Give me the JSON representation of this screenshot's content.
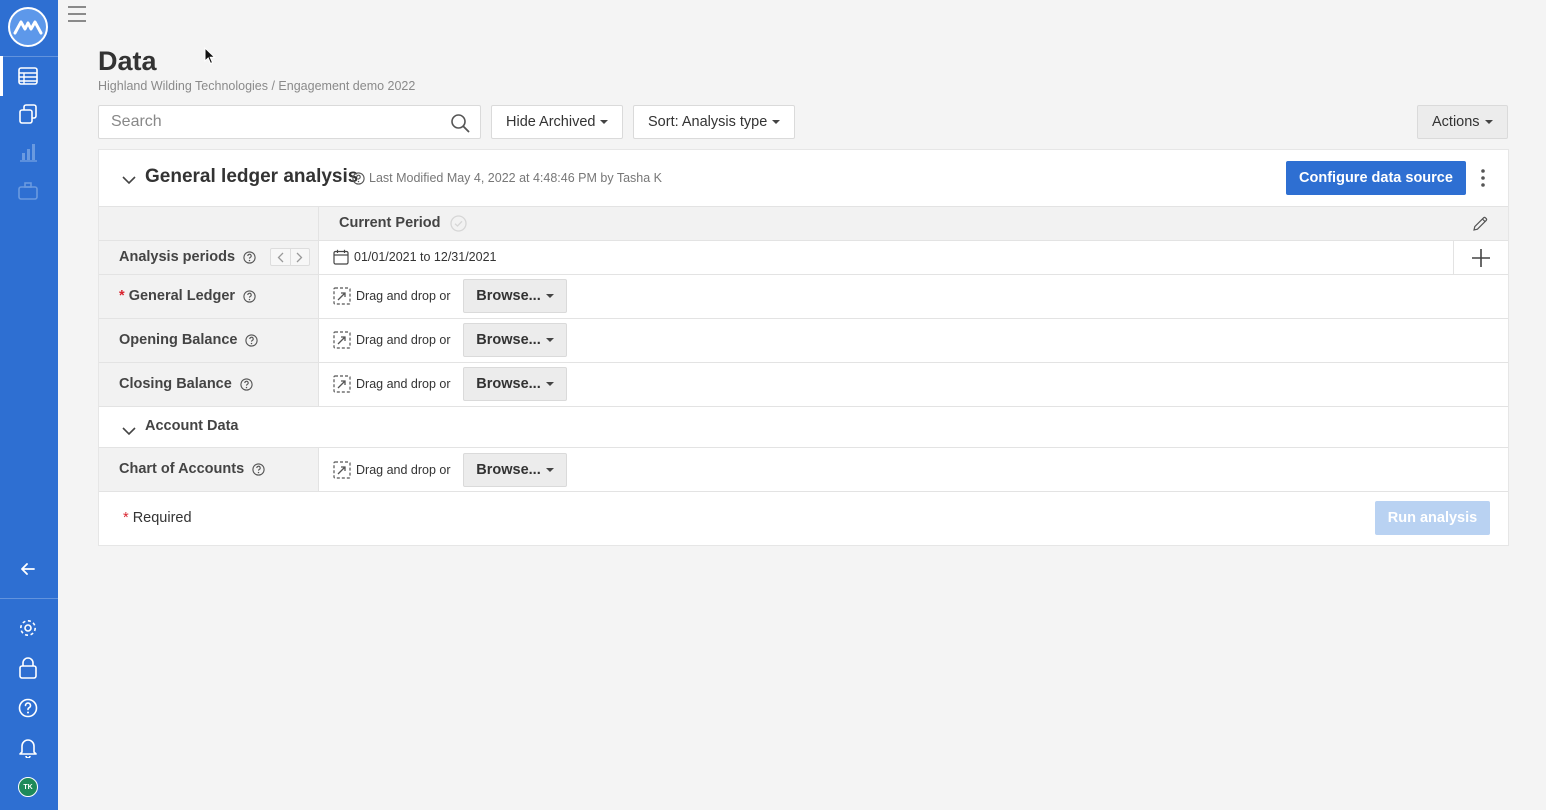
{
  "sidebar": {
    "logo_icon": "mindbridge-logo",
    "nav_items": [
      {
        "icon": "data-table-icon",
        "active": true
      },
      {
        "icon": "documents-icon",
        "active": false
      },
      {
        "icon": "bar-chart-icon",
        "active": false
      },
      {
        "icon": "briefcase-icon",
        "active": false
      }
    ],
    "bottom_items": [
      "collapse-arrow-icon",
      "gear-icon",
      "lock-icon",
      "help-icon",
      "bell-icon"
    ],
    "avatar_initials": "TK",
    "color": "#2e6fd2"
  },
  "page": {
    "title": "Data",
    "breadcrumb": "Highland Wilding Technologies / Engagement demo 2022"
  },
  "toolbar": {
    "search_placeholder": "Search",
    "search_value": "",
    "hide_archived_label": "Hide Archived",
    "sort_label": "Sort: Analysis type",
    "actions_label": "Actions"
  },
  "analysis": {
    "title": "General ledger analysis",
    "last_modified": "Last Modified May 4, 2022 at 4:48:46 PM by Tasha K",
    "configure_label": "Configure data source",
    "period_column": "Current Period",
    "analysis_periods_label": "Analysis periods",
    "date_range": "01/01/2021 to 12/31/2021",
    "rows": [
      {
        "label": "General Ledger",
        "required": true
      },
      {
        "label": "Opening Balance",
        "required": false
      },
      {
        "label": "Closing Balance",
        "required": false
      }
    ],
    "account_section_title": "Account Data",
    "account_rows": [
      {
        "label": "Chart of Accounts",
        "required": false
      }
    ],
    "drag_text": "Drag and drop or",
    "browse_label": "Browse...",
    "required_star": "*",
    "required_note": "Required",
    "run_label": "Run analysis",
    "accent_color": "#2e6fd2",
    "required_color": "#d9242f"
  }
}
